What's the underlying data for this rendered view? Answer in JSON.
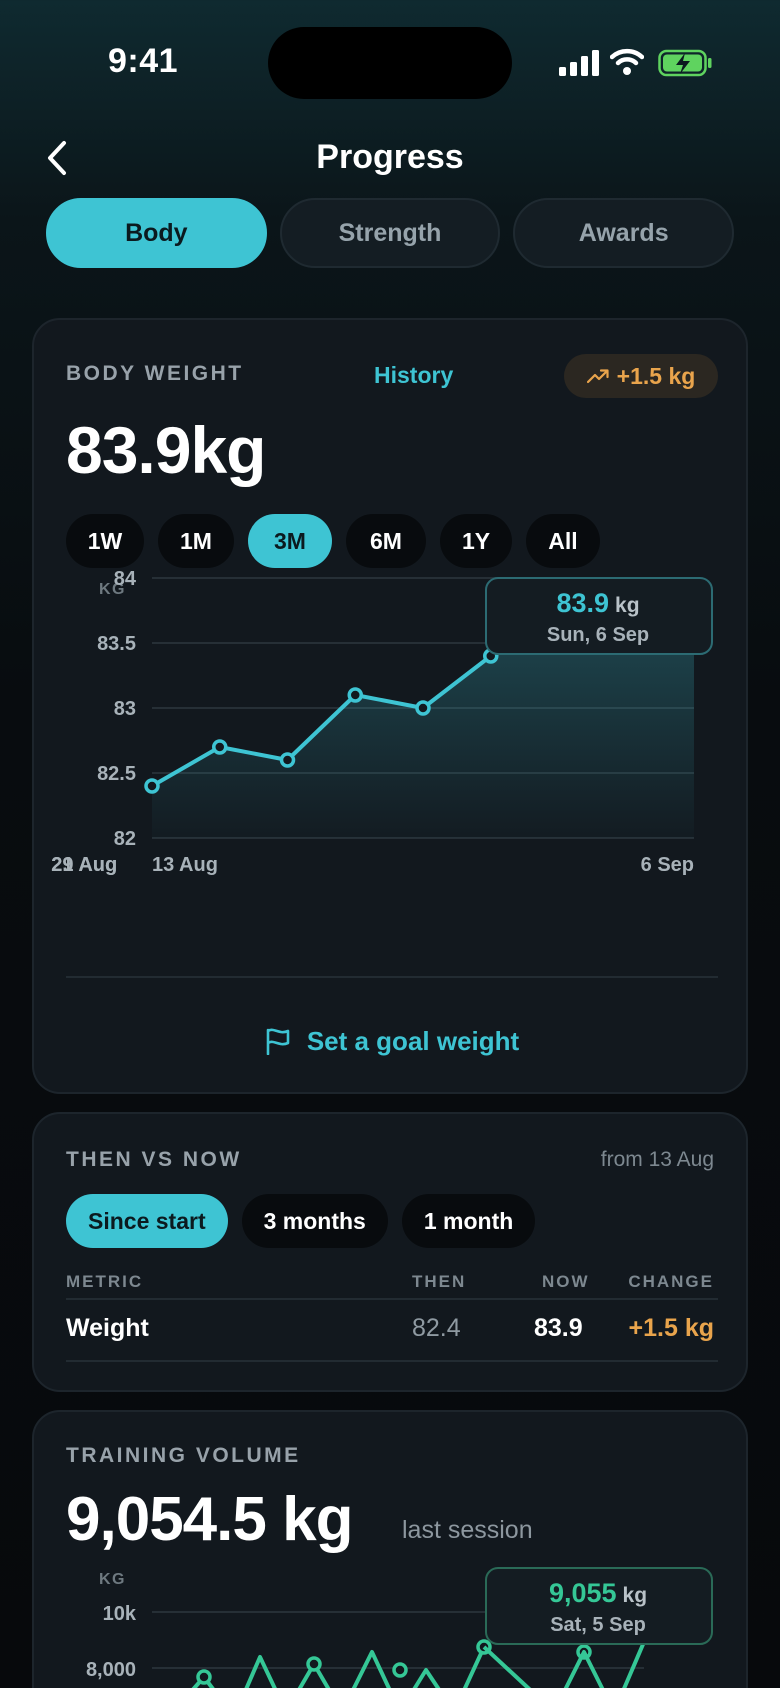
{
  "status": {
    "time": "9:41"
  },
  "header": {
    "title": "Progress"
  },
  "tabs": [
    {
      "label": "Body",
      "active": true
    },
    {
      "label": "Strength",
      "active": false
    },
    {
      "label": "Awards",
      "active": false
    }
  ],
  "weight_card": {
    "label": "BODY WEIGHT",
    "history_link": "History",
    "delta": "+1.5 kg",
    "value": "83.9kg",
    "ranges": [
      {
        "label": "1W",
        "active": false
      },
      {
        "label": "1M",
        "active": false
      },
      {
        "label": "3M",
        "active": true
      },
      {
        "label": "6M",
        "active": false
      },
      {
        "label": "1Y",
        "active": false
      },
      {
        "label": "All",
        "active": false
      }
    ],
    "goal_button": "Set a goal weight"
  },
  "chart_data": [
    {
      "type": "area",
      "ylabel": "KG",
      "ylim": [
        82,
        84
      ],
      "y_ticks": [
        "84",
        "83.5",
        "83",
        "82.5",
        "82"
      ],
      "x_ticks": [
        "13 Aug",
        "21 Aug",
        "29 Aug",
        "6 Sep"
      ],
      "x": [
        "13 Aug",
        "16 Aug",
        "19 Aug",
        "22 Aug",
        "25 Aug",
        "28 Aug",
        "31 Aug",
        "3 Sep",
        "6 Sep"
      ],
      "values": [
        82.4,
        82.7,
        82.6,
        83.1,
        83.0,
        83.4,
        83.6,
        83.5,
        83.9
      ],
      "tooltip": {
        "value": "83.9",
        "unit": "kg",
        "date": "Sun, 6 Sep"
      },
      "color": "#3ec4d3"
    },
    {
      "type": "line",
      "ylabel": "KG",
      "y_ticks": [
        "10k",
        "8,000"
      ],
      "tooltip": {
        "value": "9,055",
        "unit": "kg",
        "date": "Sat, 5 Sep"
      },
      "color": "#35c796"
    }
  ],
  "compare_card": {
    "label": "THEN VS NOW",
    "from": "from 13 Aug",
    "periods": [
      {
        "label": "Since start",
        "active": true
      },
      {
        "label": "3 months",
        "active": false
      },
      {
        "label": "1 month",
        "active": false
      }
    ],
    "columns": [
      "METRIC",
      "THEN",
      "NOW",
      "CHANGE"
    ],
    "rows": [
      {
        "metric": "Weight",
        "then": "82.4",
        "now": "83.9",
        "change": "+1.5 kg"
      }
    ]
  },
  "volume_card": {
    "label": "TRAINING VOLUME",
    "value": "9,054.5 kg",
    "note": "last session"
  },
  "colors": {
    "accent": "#3ec4d3",
    "positive_change": "#e9a44c",
    "volume": "#35c796"
  }
}
